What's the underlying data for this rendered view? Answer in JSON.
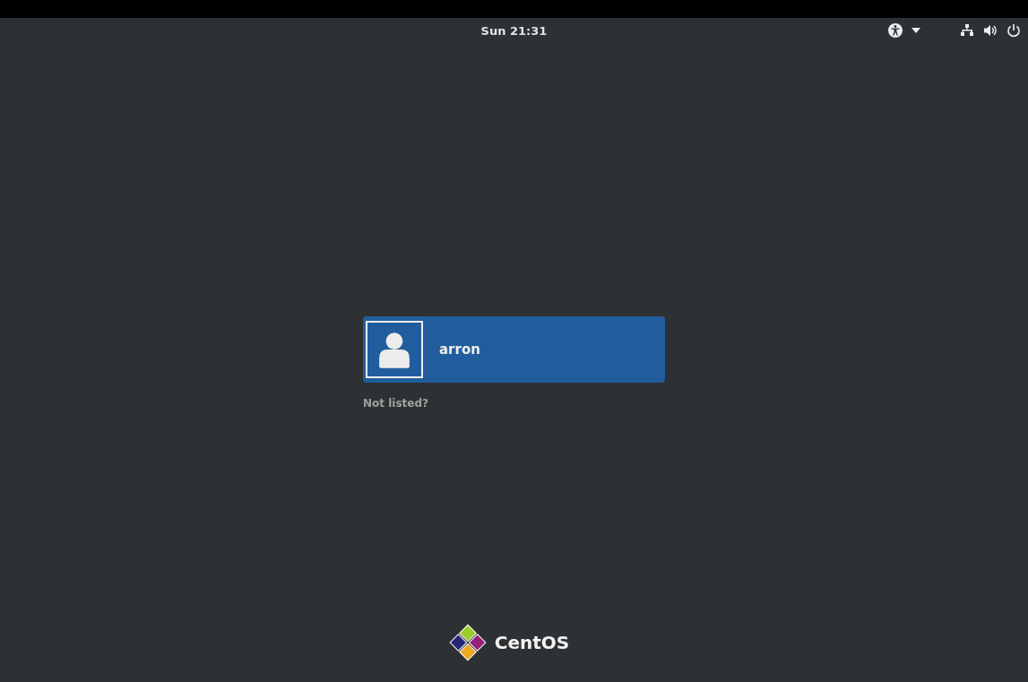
{
  "top_bar": {
    "clock": "Sun 21:31"
  },
  "users": [
    {
      "name": "arron",
      "selected": true
    }
  ],
  "not_listed": "Not listed?",
  "logo": {
    "text": "CentOS"
  }
}
